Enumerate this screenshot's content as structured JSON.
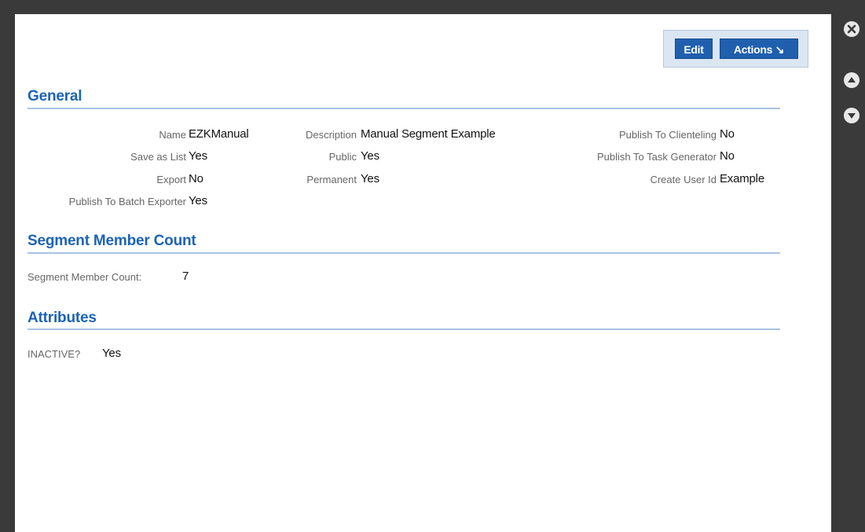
{
  "toolbar": {
    "edit_label": "Edit",
    "actions_label": "Actions ↘"
  },
  "sections": {
    "general": "General",
    "segment_member_count": "Segment Member Count",
    "attributes": "Attributes"
  },
  "general": {
    "name": {
      "label": "Name",
      "value": "EZKManual"
    },
    "save_as_list": {
      "label": "Save as List",
      "value": "Yes"
    },
    "export": {
      "label": "Export",
      "value": "No"
    },
    "publish_batch_exporter": {
      "label": "Publish To Batch Exporter",
      "value": "Yes"
    },
    "description": {
      "label": "Description",
      "value": "Manual Segment Example"
    },
    "public": {
      "label": "Public",
      "value": "Yes"
    },
    "permanent": {
      "label": "Permanent",
      "value": "Yes"
    },
    "publish_clienteling": {
      "label": "Publish To Clienteling",
      "value": "No"
    },
    "publish_task_generator": {
      "label": "Publish To Task Generator",
      "value": "No"
    },
    "create_user_id": {
      "label": "Create User Id",
      "value": "Example"
    }
  },
  "segment_count": {
    "label": "Segment Member Count:",
    "value": "7"
  },
  "attributes": {
    "inactive": {
      "label": "INACTIVE?",
      "value": "Yes"
    }
  },
  "side_icons": [
    "close-icon",
    "arrow-up-icon",
    "arrow-down-icon"
  ],
  "colors": {
    "accent": "#1d63b3",
    "button": "#1f5fae",
    "background": "#3a3a3a"
  }
}
